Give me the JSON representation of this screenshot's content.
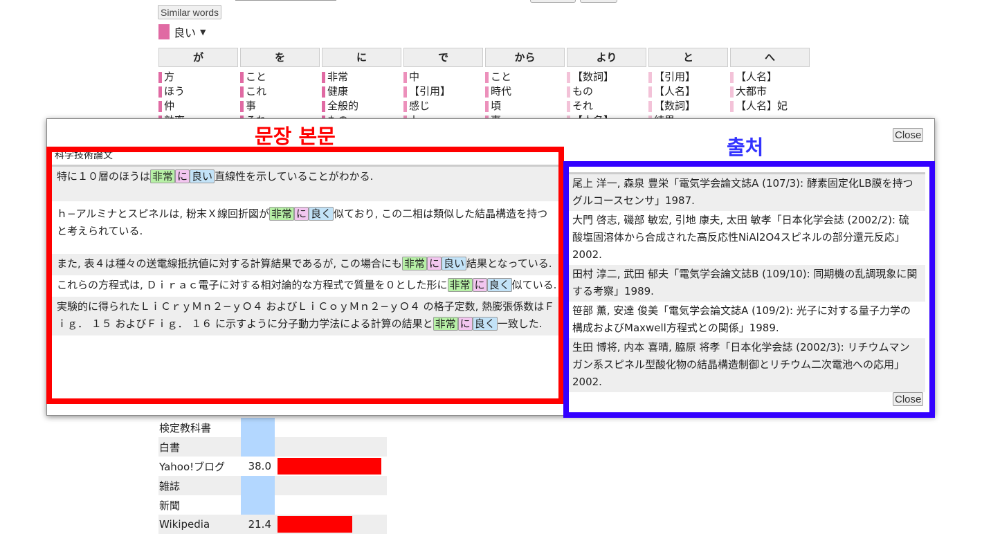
{
  "page": {
    "similar_words_label": "Similar words",
    "selected_word": "良い",
    "accent_color": "#e06aa3"
  },
  "columns": [
    {
      "header": "が",
      "items": [
        "方",
        "ほう",
        "仲",
        "効率"
      ]
    },
    {
      "header": "を",
      "items": [
        "こと",
        "これ",
        "事",
        "それ"
      ]
    },
    {
      "header": "に",
      "items": [
        "非常",
        "健康",
        "全般的",
        "もの"
      ]
    },
    {
      "header": "で",
      "items": [
        "中",
        "【引用】",
        "感じ",
        "上"
      ]
    },
    {
      "header": "から",
      "items": [
        "こと",
        "時代",
        "頃",
        "事"
      ]
    },
    {
      "header": "より",
      "items": [
        "【数詞】",
        "もの",
        "それ",
        "【人名】"
      ]
    },
    {
      "header": "と",
      "items": [
        "【引用】",
        "【人名】",
        "【数詞】",
        "結果"
      ]
    },
    {
      "header": "へ",
      "items": [
        "【人名】",
        "大都市",
        "【人名】妃"
      ]
    }
  ],
  "stats": [
    {
      "label": "検定教科書",
      "value": "",
      "ratio": 0
    },
    {
      "label": "白書",
      "value": "",
      "ratio": 0
    },
    {
      "label": "Yahoo!ブログ",
      "value": "38.0",
      "ratio": 1.0
    },
    {
      "label": "雑誌",
      "value": "",
      "ratio": 0
    },
    {
      "label": "新聞",
      "value": "",
      "ratio": 0
    },
    {
      "label": "Wikipedia",
      "value": "21.4",
      "ratio": 0.72
    }
  ],
  "modal": {
    "close_label": "Close",
    "label_body": "문장 본문",
    "label_source": "출처",
    "label_body_color": "#ff0000",
    "label_source_color": "#3333ff",
    "section_title": "科学技術論文",
    "sentences": [
      {
        "pre": "特に１０層のほうは",
        "h1": "非常",
        "h2": "に",
        "h3": "良い",
        "post": "直線性を示していることがわかる."
      },
      {
        "pre": "ｈ−アルミナとスピネルは, 粉末Ｘ線回折図が",
        "h1": "非常",
        "h2": "に",
        "h3": "良く",
        "post": "似ており, この二相は類似した結晶構造を持つと考えられている."
      },
      {
        "pre": "また, 表４は種々の送電線抵抗値に対する計算結果であるが, この場合にも",
        "h1": "非常",
        "h2": "に",
        "h3": "良い",
        "post": "結果となっている."
      },
      {
        "pre": "これらの方程式は, Ｄｉｒａｃ電子に対する相対論的な方程式で質量を０とした形に",
        "h1": "非常",
        "h2": "に",
        "h3": "良く",
        "post": "似ている."
      },
      {
        "pre": "実験的に得られたＬｉＣｒｙＭｎ２−ｙＯ４ およびＬｉＣｏｙＭｎ２−ｙＯ４ の格子定数, 熱膨張係数はＦｉｇ． １５ およびＦｉｇ． １６ に示すように分子動力学法による計算の結果と",
        "h1": "非常",
        "h2": "に",
        "h3": "良く",
        "post": "一致した."
      }
    ],
    "sources": [
      "尾上 洋一, 森泉 豊栄「電気学会論文誌A (107/3): 酵素固定化LB膜を持つグルコースセンサ」1987.",
      "大門 啓志, 磯部 敏宏, 引地 康夫, 太田 敏孝「日本化学会誌 (2002/2): 硫酸塩固溶体から合成された高反応性NiAl2O4スピネルの部分還元反応」2002.",
      "田村 淳二, 武田 郁夫「電気学会論文誌B (109/10): 同期機の乱調現象に関する考察」1989.",
      "笹部 薫, 安達 俊美「電気学会論文誌A (109/2): 光子に対する量子力学の構成およびMaxwell方程式との関係」1989.",
      "生田 博将, 内本 喜晴, 脇原 将孝「日本化学会誌 (2002/3): リチウムマンガン系スピネル型酸化物の結晶構造制御とリチウム二次電池への応用」2002."
    ]
  }
}
